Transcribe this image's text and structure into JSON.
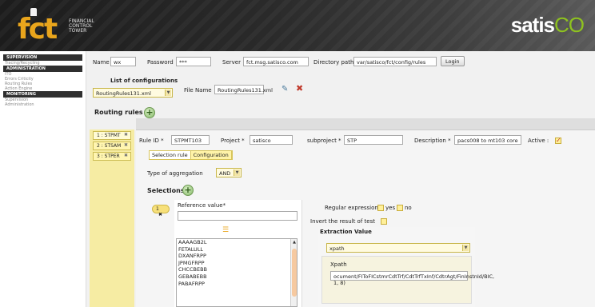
{
  "header": {
    "logo_text": "fct",
    "logo_tagline": [
      "FINANCIAL",
      "CONTROL",
      "TOWER"
    ],
    "brand": "satis",
    "brand_accent": "CO"
  },
  "sidebar": {
    "groups": [
      {
        "title": "SUPERVISION",
        "items": [
          "Tracing/Recycling"
        ]
      },
      {
        "title": "ADMINISTRATION",
        "items": [
          "ITO",
          "Errors Criticity",
          "Routing Rules",
          "Action Engine"
        ]
      },
      {
        "title": "MONITORING",
        "items": [
          "Supervision",
          "Administration"
        ]
      }
    ]
  },
  "connection": {
    "name_label": "Name",
    "name_value": "wx",
    "password_label": "Password",
    "password_value": "***",
    "server_label": "Server",
    "server_value": "fct.msg.satisco.com",
    "dir_label": "Directory path",
    "dir_value": "var/satisco/fct/config/rules",
    "login_label": "Login"
  },
  "configs": {
    "list_label": "List of configurations",
    "selected": "RoutingRules131.xml",
    "filename_label": "File Name",
    "filename_value": "RoutingRules131.xml"
  },
  "routing": {
    "title": "Routing rules",
    "rules": [
      {
        "label": "1 : STPMT"
      },
      {
        "label": "2 : STSAM"
      },
      {
        "label": "3 : STPER"
      }
    ],
    "close_glyph": "✖"
  },
  "rule_detail": {
    "rule_id_label": "Rule ID *",
    "rule_id_value": "STPMT103",
    "project_label": "Project *",
    "project_value": "satisco",
    "subproject_label": "subproject *",
    "subproject_value": "STP",
    "description_label": "Description *",
    "description_value": "pacs008 to mt103 core",
    "active_label": "Active :",
    "tabs": [
      "Selection rule",
      "Configuration"
    ],
    "aggregation_label": "Type of aggregation",
    "aggregation_value": "AND"
  },
  "selections": {
    "title": "Selections",
    "pill": "1",
    "pill_close": "✖",
    "ref_label": "Reference value*",
    "values": [
      "AAAAGB2L",
      "FETALULL",
      "DXANFRPP",
      "JPMGFRPP",
      "CHCCBEBB",
      "GEBABEBB",
      "PABAFRPP"
    ],
    "regex_label": "Regular expression",
    "yes_label": "yes",
    "no_label": "no",
    "invert_label": "Invert the result of test",
    "extraction_label": "Extraction Value",
    "extraction_type": "xpath",
    "xpath_label": "Xpath",
    "xpath_value": "ocument/FIToFICstmrCdtTrf/CdtTrfTxInf/CdtrAgt/FinInstnId/BIC, 1, 8)"
  }
}
